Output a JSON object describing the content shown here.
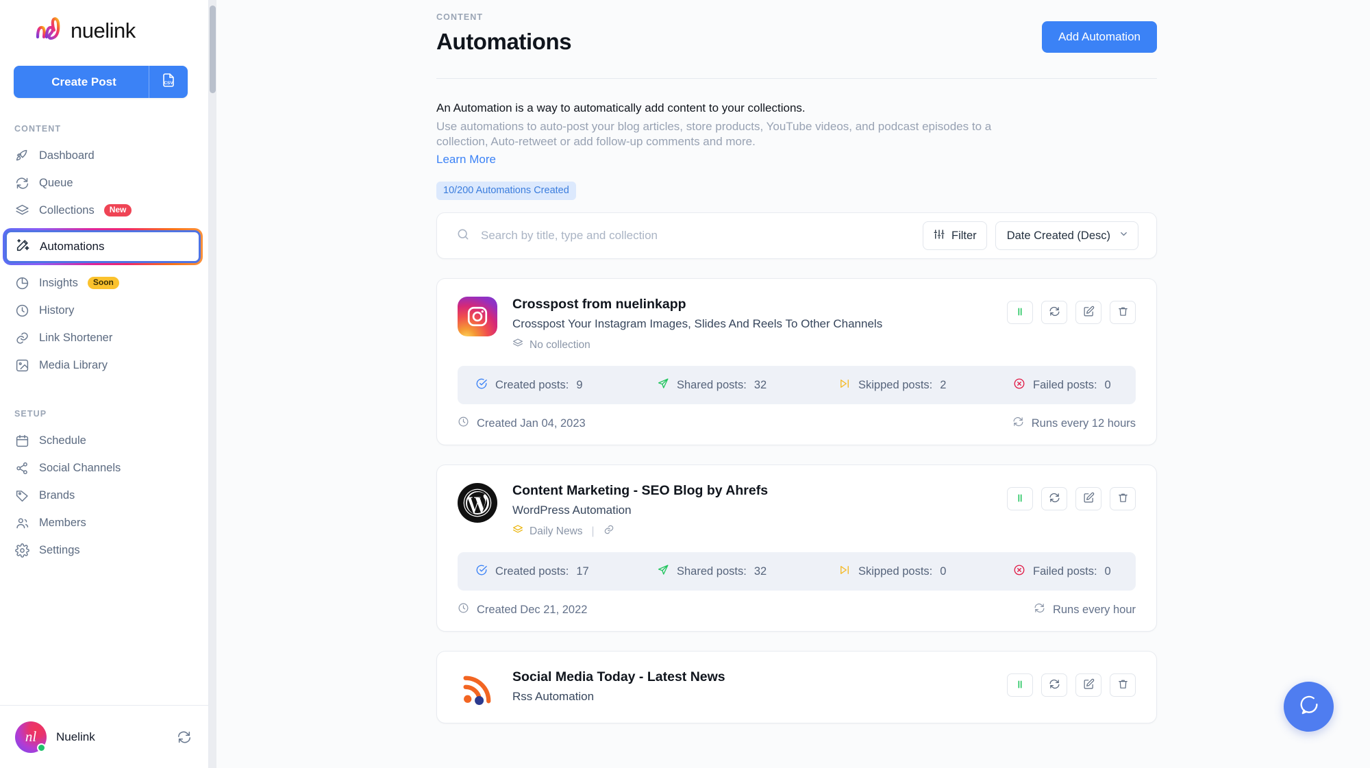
{
  "brand": {
    "name": "nuelink",
    "logo_icon": "nuelink-logo"
  },
  "sidebar": {
    "create_post_label": "Create Post",
    "csv_icon": "csv-file-icon",
    "sections": [
      {
        "label": "CONTENT",
        "items": [
          {
            "label": "Dashboard",
            "icon": "rocket-icon",
            "badge": ""
          },
          {
            "label": "Queue",
            "icon": "refresh-icon",
            "badge": ""
          },
          {
            "label": "Collections",
            "icon": "layers-icon",
            "badge": "New"
          },
          {
            "label": "Automations",
            "icon": "magic-wand-icon",
            "badge": "",
            "active": true
          },
          {
            "label": "Insights",
            "icon": "pie-chart-icon",
            "badge": "Soon"
          },
          {
            "label": "History",
            "icon": "clock-icon",
            "badge": ""
          },
          {
            "label": "Link Shortener",
            "icon": "link-icon",
            "badge": ""
          },
          {
            "label": "Media Library",
            "icon": "image-icon",
            "badge": ""
          }
        ]
      },
      {
        "label": "SETUP",
        "items": [
          {
            "label": "Schedule",
            "icon": "calendar-icon",
            "badge": ""
          },
          {
            "label": "Social Channels",
            "icon": "share-icon",
            "badge": ""
          },
          {
            "label": "Brands",
            "icon": "tag-icon",
            "badge": ""
          },
          {
            "label": "Members",
            "icon": "users-icon",
            "badge": ""
          },
          {
            "label": "Settings",
            "icon": "gear-icon",
            "badge": ""
          }
        ]
      }
    ],
    "footer": {
      "workspace_name": "Nuelink",
      "avatar_initials": "nl",
      "switch_icon": "switch-workspace-icon",
      "status": "online"
    }
  },
  "header": {
    "eyebrow": "CONTENT",
    "title": "Automations",
    "add_button_label": "Add Automation"
  },
  "intro": {
    "title": "An Automation is a way to automatically add content to your collections.",
    "description": "Use automations to auto-post your blog articles, store products, YouTube videos, and podcast episodes to a collection, Auto-retweet or add follow-up comments and more.",
    "learn_more_label": "Learn More",
    "quota_label": "10/200 Automations Created"
  },
  "search": {
    "placeholder": "Search by title, type and collection",
    "value": "",
    "search_icon": "search-icon",
    "filter_label": "Filter",
    "filter_icon": "sliders-icon",
    "sort_value": "Date Created (Desc)",
    "sort_chevron_icon": "chevron-down-icon"
  },
  "stat_labels": {
    "created": "Created posts:",
    "shared": "Shared posts:",
    "skipped": "Skipped posts:",
    "failed": "Failed posts:"
  },
  "actions": {
    "pause": "pause-icon",
    "sync": "refresh-icon",
    "edit": "edit-icon",
    "delete": "trash-icon"
  },
  "automations": [
    {
      "logo": "instagram-icon",
      "title": "Crosspost from nuelinkapp",
      "subtitle": "Crosspost Your Instagram Images, Slides And Reels To Other Channels",
      "collection": "No collection",
      "has_link": false,
      "created_posts": "9",
      "shared_posts": "32",
      "skipped_posts": "2",
      "failed_posts": "0",
      "created_label": "Created Jan 04, 2023",
      "runs_label": "Runs every 12 hours"
    },
    {
      "logo": "wordpress-icon",
      "title": "Content Marketing - SEO Blog by Ahrefs",
      "subtitle": "WordPress Automation",
      "collection": "Daily News",
      "has_link": true,
      "created_posts": "17",
      "shared_posts": "32",
      "skipped_posts": "0",
      "failed_posts": "0",
      "created_label": "Created Dec 21, 2022",
      "runs_label": "Runs every hour"
    },
    {
      "logo": "rss-icon",
      "title": "Social Media Today - Latest News",
      "subtitle": "Rss Automation",
      "collection": "",
      "has_link": false,
      "created_posts": "",
      "shared_posts": "",
      "skipped_posts": "",
      "failed_posts": "",
      "created_label": "",
      "runs_label": ""
    }
  ],
  "help": {
    "icon": "chat-bubble-icon"
  },
  "colors": {
    "primary": "#3b82f6",
    "badge_new": "#ef4455",
    "badge_soon": "#fbc22d",
    "quota_bg": "#dce9fd",
    "quota_text": "#3b7ddd",
    "stat_created": "#3b82f6",
    "stat_shared": "#22c55e",
    "stat_skipped": "#f5b820",
    "stat_failed": "#e11d48",
    "pause_green": "#22c55e"
  }
}
